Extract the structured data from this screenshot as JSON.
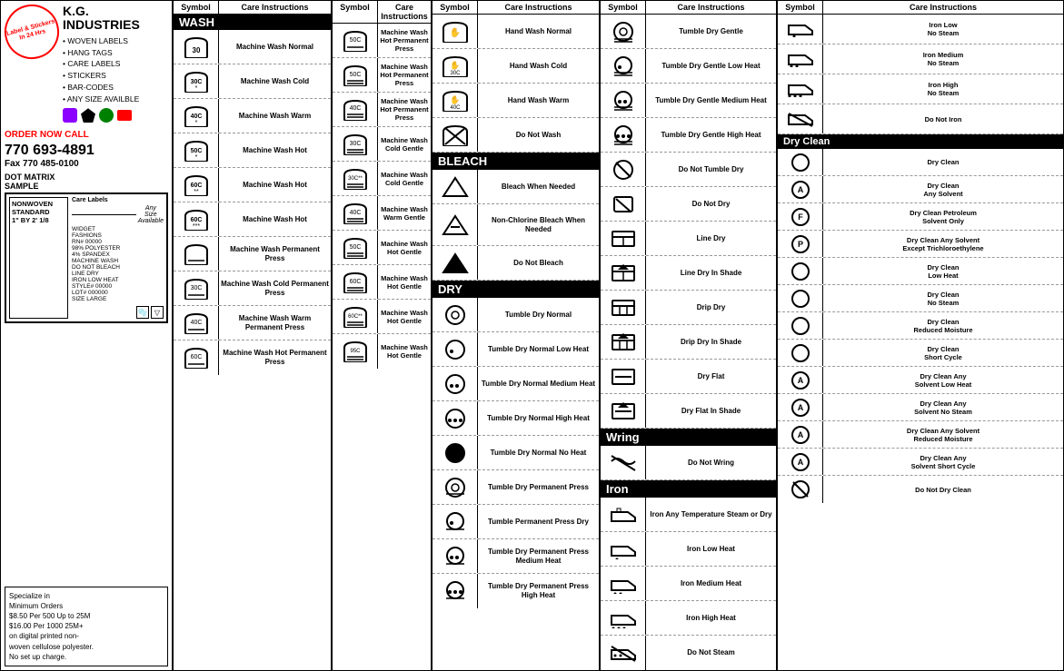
{
  "sidebar": {
    "badge": "Label & Stickers\nIn 24 Hrs",
    "company": "K.G. INDUSTRIES",
    "bullets": [
      "WOVEN LABELS",
      "HANG TAGS",
      "CARE LABELS",
      "STICKERS",
      "BAR-CODES",
      "ANY SIZE AVAILBLE"
    ],
    "order_call": "ORDER NOW CALL",
    "phone": "770 693-4891",
    "fax": "Fax 770 485-0100",
    "dot_matrix": "DOT MATRIX\nSAMPLE",
    "nonwoven": "NONWOVEN\nSTANDARD\n1\" BY 2' 1/8",
    "widget_fashions": "WIDGET\nFASHIONS\nRN# 00000\n98% POLYESTER\n4% SPANDEX\nMACHINE WASH\nDO NOT BLEACH\nLINE DRY\nIRON LOW HEAT\nSTYLE# 00000\nLOT# 000000\nSIZE LARGE",
    "any_size": "Any\nSize\nAvailable",
    "care_labels": "Care Labels",
    "specialize": "Specialize in\nMinimum Orders\n$8.50 Per 500 Up to 25M\n$16.00 Per 1000 25M+\non digital printed non-\nwoven cellulose polyester.\nNo set up charge."
  },
  "columns": {
    "col1_header": "Symbol",
    "col2_header": "Care Instructions",
    "wash_header": "WASH",
    "col3_header": "Symbol",
    "col4_header": "Care Instructions",
    "col5_header": "Symbol",
    "col6_header": "Care Instructions",
    "dry_header": "DRY",
    "bleach_header": "BLEACH",
    "col7_header": "Symbol",
    "col8_header": "Care Instructions",
    "drip_section": "WRING",
    "iron_section": "IRON",
    "col9_header": "Symbol",
    "col10_header": "Care Instructions"
  },
  "wash_rows": [
    {
      "label": "Machine Wash Normal"
    },
    {
      "label": "Machine Wash Cold"
    },
    {
      "label": "Machine Wash Warm"
    },
    {
      "label": "Machine Wash Hot"
    },
    {
      "label": "Machine Wash Hot"
    },
    {
      "label": "Machine Wash Hot"
    },
    {
      "label": "Machine Wash Permanent Press"
    },
    {
      "label": "Machine Wash Cold Permanent Press"
    },
    {
      "label": "Machine Wash Warm Permanent Press"
    },
    {
      "label": "Machine Wash Hot Permanent Press"
    }
  ],
  "wash_rows2": [
    {
      "label": "Machine Wash Hot Permanent Press"
    },
    {
      "label": "Machine Wash Hot Permanent Press"
    },
    {
      "label": "Machine Wash Hot Permanent Press"
    },
    {
      "label": "Machine Wash Cold Gentle"
    },
    {
      "label": "Machine Wash Cold Gentle"
    },
    {
      "label": "Machine Wash Warm Gentle"
    },
    {
      "label": "Machine Wash Hot Gentle"
    },
    {
      "label": "Machine Wash Hot Gentle"
    },
    {
      "label": "Machine Wash Hot Gentle"
    },
    {
      "label": "Machine Wash Hot Gentle"
    }
  ],
  "bleach_rows": [
    {
      "label": "Hand Wash Normal"
    },
    {
      "label": "Hand Wash Cold"
    },
    {
      "label": "Hand Wash Warm"
    },
    {
      "label": "Do Not Wash"
    },
    {
      "label": "Bleach When Needed"
    },
    {
      "label": "Non-Chlorine Bleach When Needed"
    },
    {
      "label": "Do Not Bleach"
    }
  ],
  "dry_rows": [
    {
      "label": "Tumble Dry Normal"
    },
    {
      "label": "Tumble Dry Normal Low Heat"
    },
    {
      "label": "Tumble Dry Normal Medium Heat"
    },
    {
      "label": "Tumble Dry Normal High Heat"
    },
    {
      "label": "Tumble Dry Normal No Heat"
    },
    {
      "label": "Tumble Dry Permanent Press"
    },
    {
      "label": "Tumble Dry Permanent Press Low Heat"
    },
    {
      "label": "Tumble Dry Permanent Press Medium Heat"
    },
    {
      "label": "Tumble Dry Permanent Press High Heat"
    }
  ],
  "dry_rows2": [
    {
      "label": "Tumble Dry Gentle"
    },
    {
      "label": "Tumble Dry Gentle Low Heat"
    },
    {
      "label": "Tumble Dry Gentle Medium Heat"
    },
    {
      "label": "Tumble Dry Gentle High Heat"
    },
    {
      "label": "Do Not Tumble Dry"
    },
    {
      "label": "Do Not Dry"
    },
    {
      "label": "Line Dry"
    },
    {
      "label": "Line Dry In Shade"
    },
    {
      "label": "Drip Dry"
    },
    {
      "label": "Drip Dry In Shade"
    },
    {
      "label": "Dry Flat"
    },
    {
      "label": "Dry Flat In Shade"
    }
  ],
  "wring_rows": [
    {
      "label": "Do Not Wring"
    }
  ],
  "iron_rows": [
    {
      "label": "Iron Any Temperature Steam or Dry"
    },
    {
      "label": "Iron Low Heat"
    },
    {
      "label": "Iron Medium Heat"
    },
    {
      "label": "Iron High Heat"
    },
    {
      "label": "Do Not Steam"
    }
  ],
  "dryclean_rows": [
    {
      "label": "Iron Low\nNo Steam"
    },
    {
      "label": "Iron Medium\nNo Steam"
    },
    {
      "label": "Iron High\nNo Steam"
    },
    {
      "label": "Do Not Iron"
    },
    {
      "label": "Dry Clean"
    },
    {
      "label": "Dry Clean\nAny Solvent"
    },
    {
      "label": "Dry Clean Petroleum\nSolvent Only"
    },
    {
      "label": "Dry Clean Any Solvent\nExcept Trichloroethylene"
    },
    {
      "label": "Dry Clean\nLow Heat"
    },
    {
      "label": "Dry Clean\nNo Steam"
    },
    {
      "label": "Dry Clean\nReduced Moisture"
    },
    {
      "label": "Dry Clean\nShort Cycle"
    },
    {
      "label": "Dry Clean Any\nSolvent Low Heat"
    },
    {
      "label": "Dry Clean Any\nSolvent No Steam"
    },
    {
      "label": "Dry Clean Any Solvent\nReduced Moisture"
    },
    {
      "label": "Dry Clean Any\nSolvent Short Cycle"
    },
    {
      "label": "Do Not Dry Clean"
    }
  ]
}
